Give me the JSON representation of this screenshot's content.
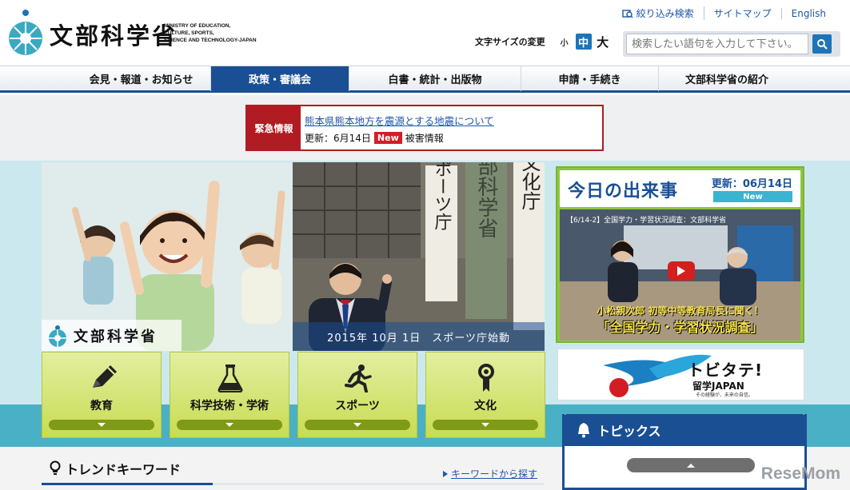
{
  "header": {
    "logo_jp": "文部科学省",
    "logo_en": "MINISTRY OF EDUCATION,\nCULTURE, SPORTS,\nSCIENCE AND TECHNOLOGY-JAPAN",
    "utility_links": [
      "絞り込み検索",
      "サイトマップ",
      "English"
    ],
    "font_size_label": "文字サイズの変更",
    "font_sizes": [
      "小",
      "中",
      "大"
    ],
    "search_placeholder": "検索したい語句を入力して下さい。"
  },
  "nav": {
    "items": [
      "会見・報道・お知らせ",
      "政策・審議会",
      "白書・統計・出版物",
      "申請・手続き",
      "文部科学省の紹介"
    ],
    "active_index": 1
  },
  "alert": {
    "tag": "緊急情報",
    "link": "熊本県熊本地方を震源とする地震について",
    "updated": "更新：6月14日",
    "new_badge": "New",
    "category": "被害情報"
  },
  "hero": {
    "logo_text": "文部科学省",
    "caption": "2015年 10月 1日　スポーツ庁始動",
    "signs": [
      "スポーツ庁",
      "文部科学省",
      "文化庁"
    ]
  },
  "categories": [
    {
      "label": "教育",
      "icon": "pencil-icon"
    },
    {
      "label": "科学技術・学術",
      "icon": "flask-icon"
    },
    {
      "label": "スポーツ",
      "icon": "runner-icon"
    },
    {
      "label": "文化",
      "icon": "ribbon-icon"
    }
  ],
  "today": {
    "title": "今日の出来事",
    "updated": "更新：06月14日",
    "new_badge": "New",
    "video_title": "【6/14-2】全国学力・学習状況調査：文部科学省",
    "caption1": "小松親次郎 初等中等教育局長に聞く！",
    "caption2": "「全国学力・学習状況調査」"
  },
  "banner": {
    "title": "トビタテ!",
    "subtitle": "留学JAPAN",
    "tagline": "その経験が、未来の自信。"
  },
  "topics": {
    "title": "トピックス"
  },
  "trend": {
    "title": "トレンドキーワード",
    "link": "キーワードから探す"
  },
  "watermark": "ReseMom"
}
